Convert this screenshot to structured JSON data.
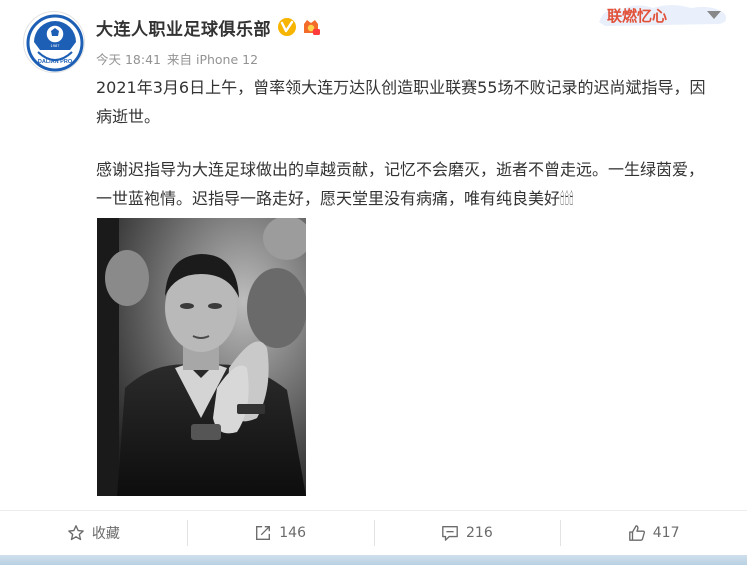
{
  "post": {
    "author": "大连人职业足球俱乐部",
    "time": "今天 18:41",
    "source": "来自 iPhone 12",
    "banner_text": "联燃忆心",
    "paragraph1": "2021年3月6日上午，曾率领大连万达队创造职业联赛55场不败记录的迟尚斌指导，因病逝世。",
    "paragraph2": "感谢迟指导为大连足球做出的卓越贡献，记忆不会磨灭，逝者不曾走远。一生绿茵爱，一世蓝袍情。迟指导一路走好，愿天堂里没有病痛，唯有纯良美好🕯🕯🕯",
    "avatar_text": "DALIAN PRO",
    "avatar_year": "1987"
  },
  "actions": {
    "favorite_label": "收藏",
    "repost_count": "146",
    "comment_count": "216",
    "like_count": "417"
  },
  "icons": {
    "verified": "verified-v-icon",
    "vip": "vip-badge-icon",
    "favorite": "star-icon",
    "repost": "share-icon",
    "comment": "comment-icon",
    "like": "thumbs-up-icon"
  },
  "colors": {
    "verified": "#f7b500",
    "avatar_blue": "#1d5fb5",
    "text": "#333333",
    "meta": "#939393"
  }
}
